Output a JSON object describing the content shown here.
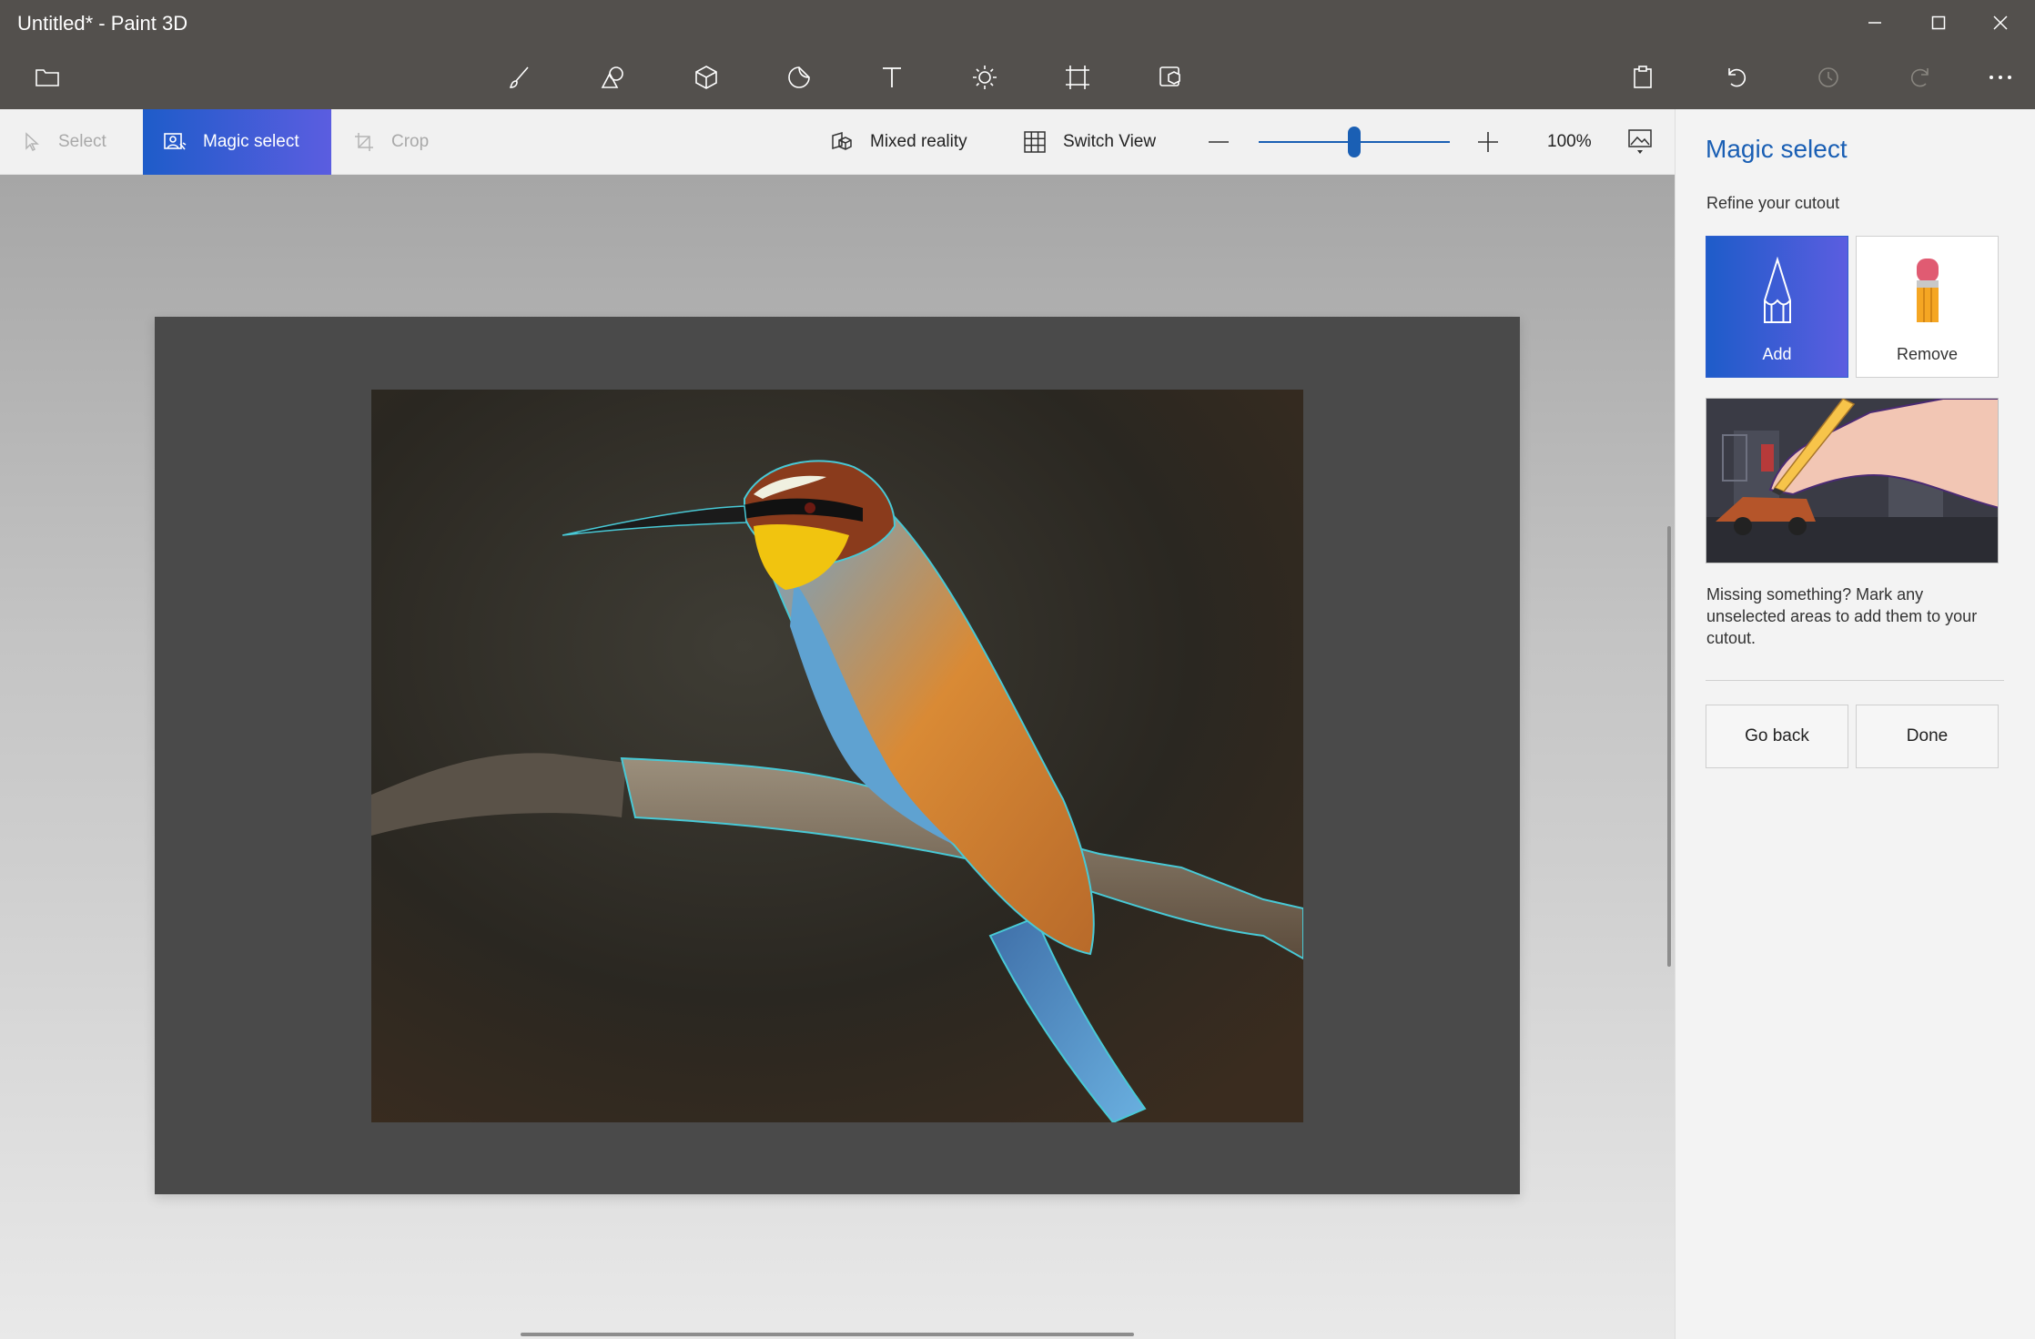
{
  "window": {
    "title": "Untitled* - Paint 3D",
    "controls": [
      "minimize-icon",
      "maximize-icon",
      "close-icon"
    ]
  },
  "toolbar": {
    "menu_icon": "folder-icon",
    "tools": [
      "brushes-icon",
      "2d-shapes-icon",
      "3d-shapes-icon",
      "stickers-icon",
      "text-icon",
      "effects-icon",
      "canvas-icon",
      "3d-library-icon"
    ],
    "right_tools": [
      "paste-icon",
      "undo-icon",
      "history-icon",
      "redo-icon",
      "more-icon"
    ]
  },
  "subbar": {
    "select_label": "Select",
    "magic_select_label": "Magic select",
    "crop_label": "Crop",
    "mixed_reality_label": "Mixed reality",
    "switch_view_label": "Switch View",
    "zoom_level": "100%",
    "zoom_fraction": 0.5,
    "colors": {
      "active_start": "#1e5cc9",
      "active_end": "#5b5de0",
      "slider": "#1a5fb4"
    }
  },
  "panel": {
    "title": "Magic select",
    "subtitle": "Refine your cutout",
    "add_label": "Add",
    "remove_label": "Remove",
    "help_text": "Missing something? Mark any unselected areas to add them to your cutout.",
    "go_back_label": "Go back",
    "done_label": "Done"
  }
}
